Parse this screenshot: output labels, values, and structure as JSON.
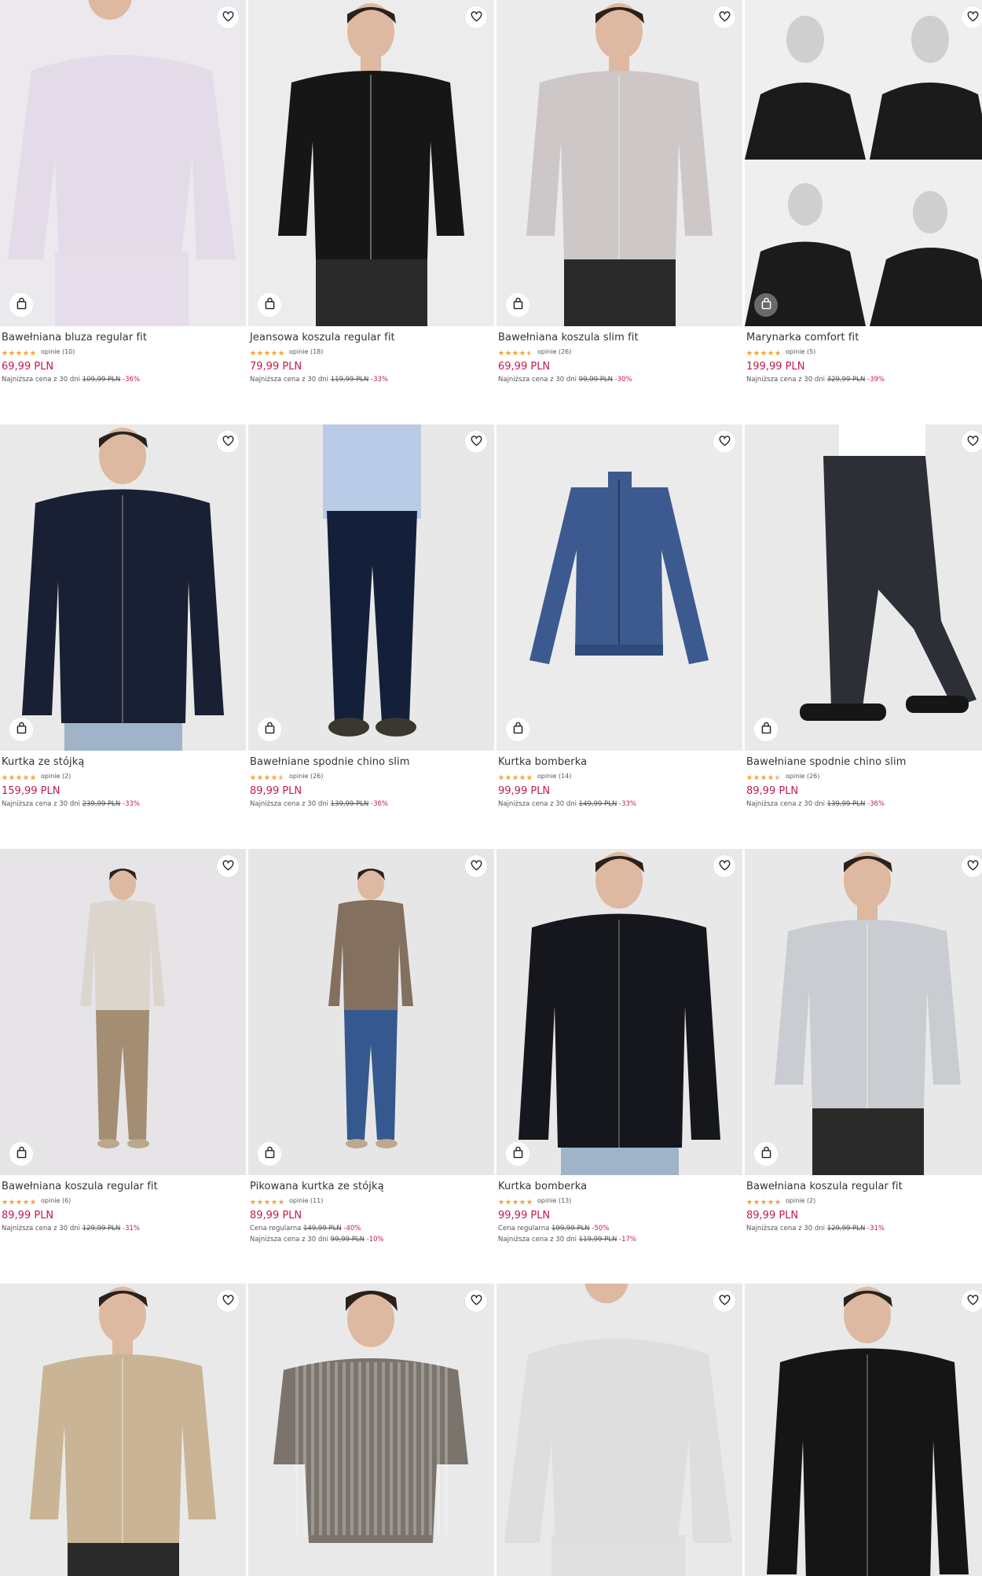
{
  "colors": {
    "price": "#c41a4e",
    "star": "#f2a93b",
    "text": "#333333"
  },
  "icons": {
    "favorite": "heart-icon",
    "add_to_cart": "shopping-bag-icon",
    "rating": "star-icon"
  },
  "products": [
    {
      "name": "Bawełniana bluza regular fit",
      "rating": 5,
      "reviews": "opinie (10)",
      "price": "69,99 PLN",
      "lowest_label": "Najniższa cena z 30 dni",
      "old_price": "109,99 PLN",
      "discount": "-36%",
      "bg": "#ebe8ee",
      "garment": "#e4dbe8",
      "type": "top",
      "bag_dark": false
    },
    {
      "name": "Jeansowa koszula regular fit",
      "rating": 5,
      "reviews": "opinie (18)",
      "price": "79,99 PLN",
      "lowest_label": "Najniższa cena z 30 dni",
      "old_price": "119,99 PLN",
      "discount": "-33%",
      "bg": "#ececec",
      "garment": "#161616",
      "type": "shirt",
      "bag_dark": false
    },
    {
      "name": "Bawełniana koszula slim fit",
      "rating": 4.5,
      "reviews": "opinie (26)",
      "price": "69,99 PLN",
      "lowest_label": "Najniższa cena z 30 dni",
      "old_price": "99,99 PLN",
      "discount": "-30%",
      "bg": "#ecebec",
      "garment": "#cdc7c7",
      "type": "shirt",
      "bag_dark": false
    },
    {
      "name": "Marynarka comfort fit",
      "rating": 5,
      "reviews": "opinie (5)",
      "price": "199,99 PLN",
      "lowest_label": "Najniższa cena z 30 dni",
      "old_price": "329,99 PLN",
      "discount": "-39%",
      "bg": "#f0f0f0",
      "garment": "#1b1b1b",
      "type": "collage",
      "bag_dark": true
    },
    {
      "name": "Kurtka ze stójką",
      "rating": 5,
      "reviews": "opinie (2)",
      "price": "159,99 PLN",
      "lowest_label": "Najniższa cena z 30 dni",
      "old_price": "239,99 PLN",
      "discount": "-33%",
      "bg": "#e9e9ea",
      "garment": "#1a2033",
      "type": "jacket",
      "bag_dark": false
    },
    {
      "name": "Bawełniane spodnie chino slim",
      "rating": 4.5,
      "reviews": "opinie (26)",
      "price": "89,99 PLN",
      "lowest_label": "Najniższa cena z 30 dni",
      "old_price": "139,99 PLN",
      "discount": "-36%",
      "bg": "#e8e8e8",
      "garment": "#142039",
      "type": "pants",
      "bag_dark": false
    },
    {
      "name": "Kurtka bomberka",
      "rating": 5,
      "reviews": "opinie (14)",
      "price": "99,99 PLN",
      "lowest_label": "Najniższa cena z 30 dni",
      "old_price": "149,99 PLN",
      "discount": "-33%",
      "bg": "#ebebeb",
      "garment": "#3c5a8f",
      "type": "flat",
      "bag_dark": false
    },
    {
      "name": "Bawełniane spodnie chino slim",
      "rating": 4.5,
      "reviews": "opinie (26)",
      "price": "89,99 PLN",
      "lowest_label": "Najniższa cena z 30 dni",
      "old_price": "139,99 PLN",
      "discount": "-36%",
      "bg": "#e9e9e9",
      "garment": "#2d2f36",
      "type": "pants2",
      "bag_dark": false
    },
    {
      "name": "Bawełniana koszula regular fit",
      "rating": 5,
      "reviews": "opinie (6)",
      "price": "89,99 PLN",
      "lowest_label": "Najniższa cena z 30 dni",
      "old_price": "129,99 PLN",
      "discount": "-31%",
      "bg": "#e6e4e6",
      "garment": "#dcd5cd",
      "type": "full",
      "pants": "#a38e74",
      "bag_dark": false
    },
    {
      "name": "Pikowana kurtka ze stójką",
      "rating": 5,
      "reviews": "opinie (11)",
      "price": "89,99 PLN",
      "regular_label": "Cena regularna",
      "regular_price": "149,99 PLN",
      "regular_discount": "-40%",
      "lowest_label": "Najniższa cena z 30 dni",
      "old_price": "99,99 PLN",
      "discount": "-10%",
      "bg": "#e7e6e7",
      "garment": "#84705e",
      "type": "full",
      "pants": "#35598e",
      "bag_dark": false
    },
    {
      "name": "Kurtka bomberka",
      "rating": 5,
      "reviews": "opinie (13)",
      "price": "99,99 PLN",
      "regular_label": "Cena regularna",
      "regular_price": "199,99 PLN",
      "regular_discount": "-50%",
      "lowest_label": "Najniższa cena z 30 dni",
      "old_price": "119,99 PLN",
      "discount": "-17%",
      "bg": "#e8e8e9",
      "garment": "#15171c",
      "type": "jacket",
      "bag_dark": false
    },
    {
      "name": "Bawełniana koszula regular fit",
      "rating": 5,
      "reviews": "opinie (2)",
      "price": "89,99 PLN",
      "lowest_label": "Najniższa cena z 30 dni",
      "old_price": "129,99 PLN",
      "discount": "-31%",
      "bg": "#e8e8e9",
      "garment": "#c9ccd0",
      "type": "shirt",
      "bag_dark": false
    },
    {
      "name": "",
      "bg": "#e9e9e9",
      "garment": "#c9b595",
      "type": "shirt",
      "partial": true
    },
    {
      "name": "",
      "bg": "#e9e9e9",
      "garment": "#7a746d",
      "type": "knit",
      "partial": true
    },
    {
      "name": "",
      "bg": "#e9e9e9",
      "garment": "#dedede",
      "type": "top",
      "partial": true
    },
    {
      "name": "",
      "bg": "#e9e9e9",
      "garment": "#151515",
      "type": "jacket",
      "partial": true
    }
  ]
}
